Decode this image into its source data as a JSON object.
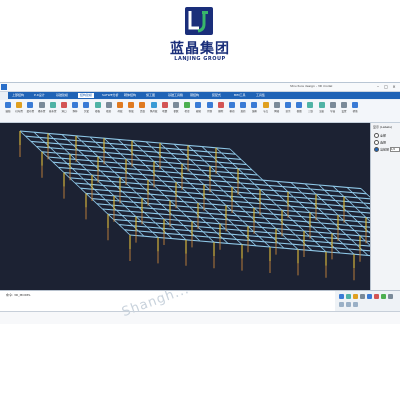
{
  "logo": {
    "name_cn": "蓝晶集团",
    "name_en": "LANJING GROUP",
    "brand_color": "#1a2e7a"
  },
  "window": {
    "title": "Structure design - 3D model",
    "minimize": "–",
    "maximize": "□",
    "close": "×"
  },
  "menu": {
    "items": [
      {
        "label": "上部结构",
        "active": false
      },
      {
        "label": "P-K设计",
        "active": false
      },
      {
        "label": "基础建模",
        "active": false
      },
      {
        "label": "结构建模",
        "active": true
      },
      {
        "label": "SATWE分析",
        "active": false
      },
      {
        "label": "砌体结构",
        "active": false
      },
      {
        "label": "施工图",
        "active": false
      },
      {
        "label": "基础工具箱",
        "active": false
      },
      {
        "label": "钢结构",
        "active": false
      },
      {
        "label": "装配式",
        "active": false
      },
      {
        "label": "BIM工具",
        "active": false
      },
      {
        "label": "工具集",
        "active": false
      }
    ],
    "accent": "#1f63b6"
  },
  "ribbon": {
    "tools": [
      {
        "label": "轴线",
        "icon": "grid-icon",
        "color": "#3a7bd5"
      },
      {
        "label": "柱布置",
        "icon": "column-icon",
        "color": "#e0a020"
      },
      {
        "label": "梁布置",
        "icon": "beam-icon",
        "color": "#3a7bd5"
      },
      {
        "label": "墙布置",
        "icon": "wall-icon",
        "color": "#7a8a99"
      },
      {
        "label": "板布置",
        "icon": "slab-icon",
        "color": "#4fb3a5"
      },
      {
        "label": "洞口",
        "icon": "opening-icon",
        "color": "#d35454"
      },
      {
        "label": "斜杆",
        "icon": "brace-icon",
        "color": "#3a7bd5"
      },
      {
        "label": "次梁",
        "icon": "joist-icon",
        "color": "#3a7bd5"
      },
      {
        "label": "楼板",
        "icon": "floor-icon",
        "color": "#4fb3a5"
      },
      {
        "label": "楼层",
        "icon": "storey-icon",
        "color": "#7a8a99"
      },
      {
        "label": "荷载",
        "icon": "load-icon",
        "color": "#e07a20"
      },
      {
        "label": "恒载",
        "icon": "deadload-icon",
        "color": "#e07a20"
      },
      {
        "label": "活载",
        "icon": "liveload-icon",
        "color": "#e07a20"
      },
      {
        "label": "风荷载",
        "icon": "wind-icon",
        "color": "#3a9bd5"
      },
      {
        "label": "地震",
        "icon": "seismic-icon",
        "color": "#d35454"
      },
      {
        "label": "参数",
        "icon": "param-icon",
        "color": "#7a8a99"
      },
      {
        "label": "检查",
        "icon": "check-icon",
        "color": "#4caf50"
      },
      {
        "label": "编辑",
        "icon": "edit-icon",
        "color": "#3a7bd5"
      },
      {
        "label": "复制",
        "icon": "copy-icon",
        "color": "#3a7bd5"
      },
      {
        "label": "删除",
        "icon": "delete-icon",
        "color": "#d35454"
      },
      {
        "label": "移动",
        "icon": "move-icon",
        "color": "#3a7bd5"
      },
      {
        "label": "旋转",
        "icon": "rotate-icon",
        "color": "#3a7bd5"
      },
      {
        "label": "镜像",
        "icon": "mirror-icon",
        "color": "#3a7bd5"
      },
      {
        "label": "节点",
        "icon": "node-icon",
        "color": "#e0a020"
      },
      {
        "label": "网格",
        "icon": "mesh-icon",
        "color": "#7a8a99"
      },
      {
        "label": "显示",
        "icon": "display-icon",
        "color": "#3a7bd5"
      },
      {
        "label": "视图",
        "icon": "view-icon",
        "color": "#3a7bd5"
      },
      {
        "label": "三维",
        "icon": "3d-icon",
        "color": "#4fb3a5"
      },
      {
        "label": "渲染",
        "icon": "render-icon",
        "color": "#4fb3a5"
      },
      {
        "label": "导出",
        "icon": "export-icon",
        "color": "#7a8a99"
      },
      {
        "label": "设置",
        "icon": "gear-icon",
        "color": "#7a8a99"
      },
      {
        "label": "帮助",
        "icon": "help-icon",
        "color": "#3a7bd5"
      }
    ]
  },
  "viewport": {
    "background": "#1c2233",
    "beam_color": "#8fc8e8",
    "column_color": "#d4b23a",
    "pile_color": "#c8853a"
  },
  "panel": {
    "title": "显示 (Labels)",
    "options": [
      {
        "label": "全部",
        "selected": false
      },
      {
        "label": "选择",
        "selected": false
      },
      {
        "label": "当前层",
        "selected": true
      }
    ],
    "input_value": "1/4"
  },
  "command": {
    "prompt": "命令: 3D_MODEL"
  },
  "watermark": "Shangh..."
}
